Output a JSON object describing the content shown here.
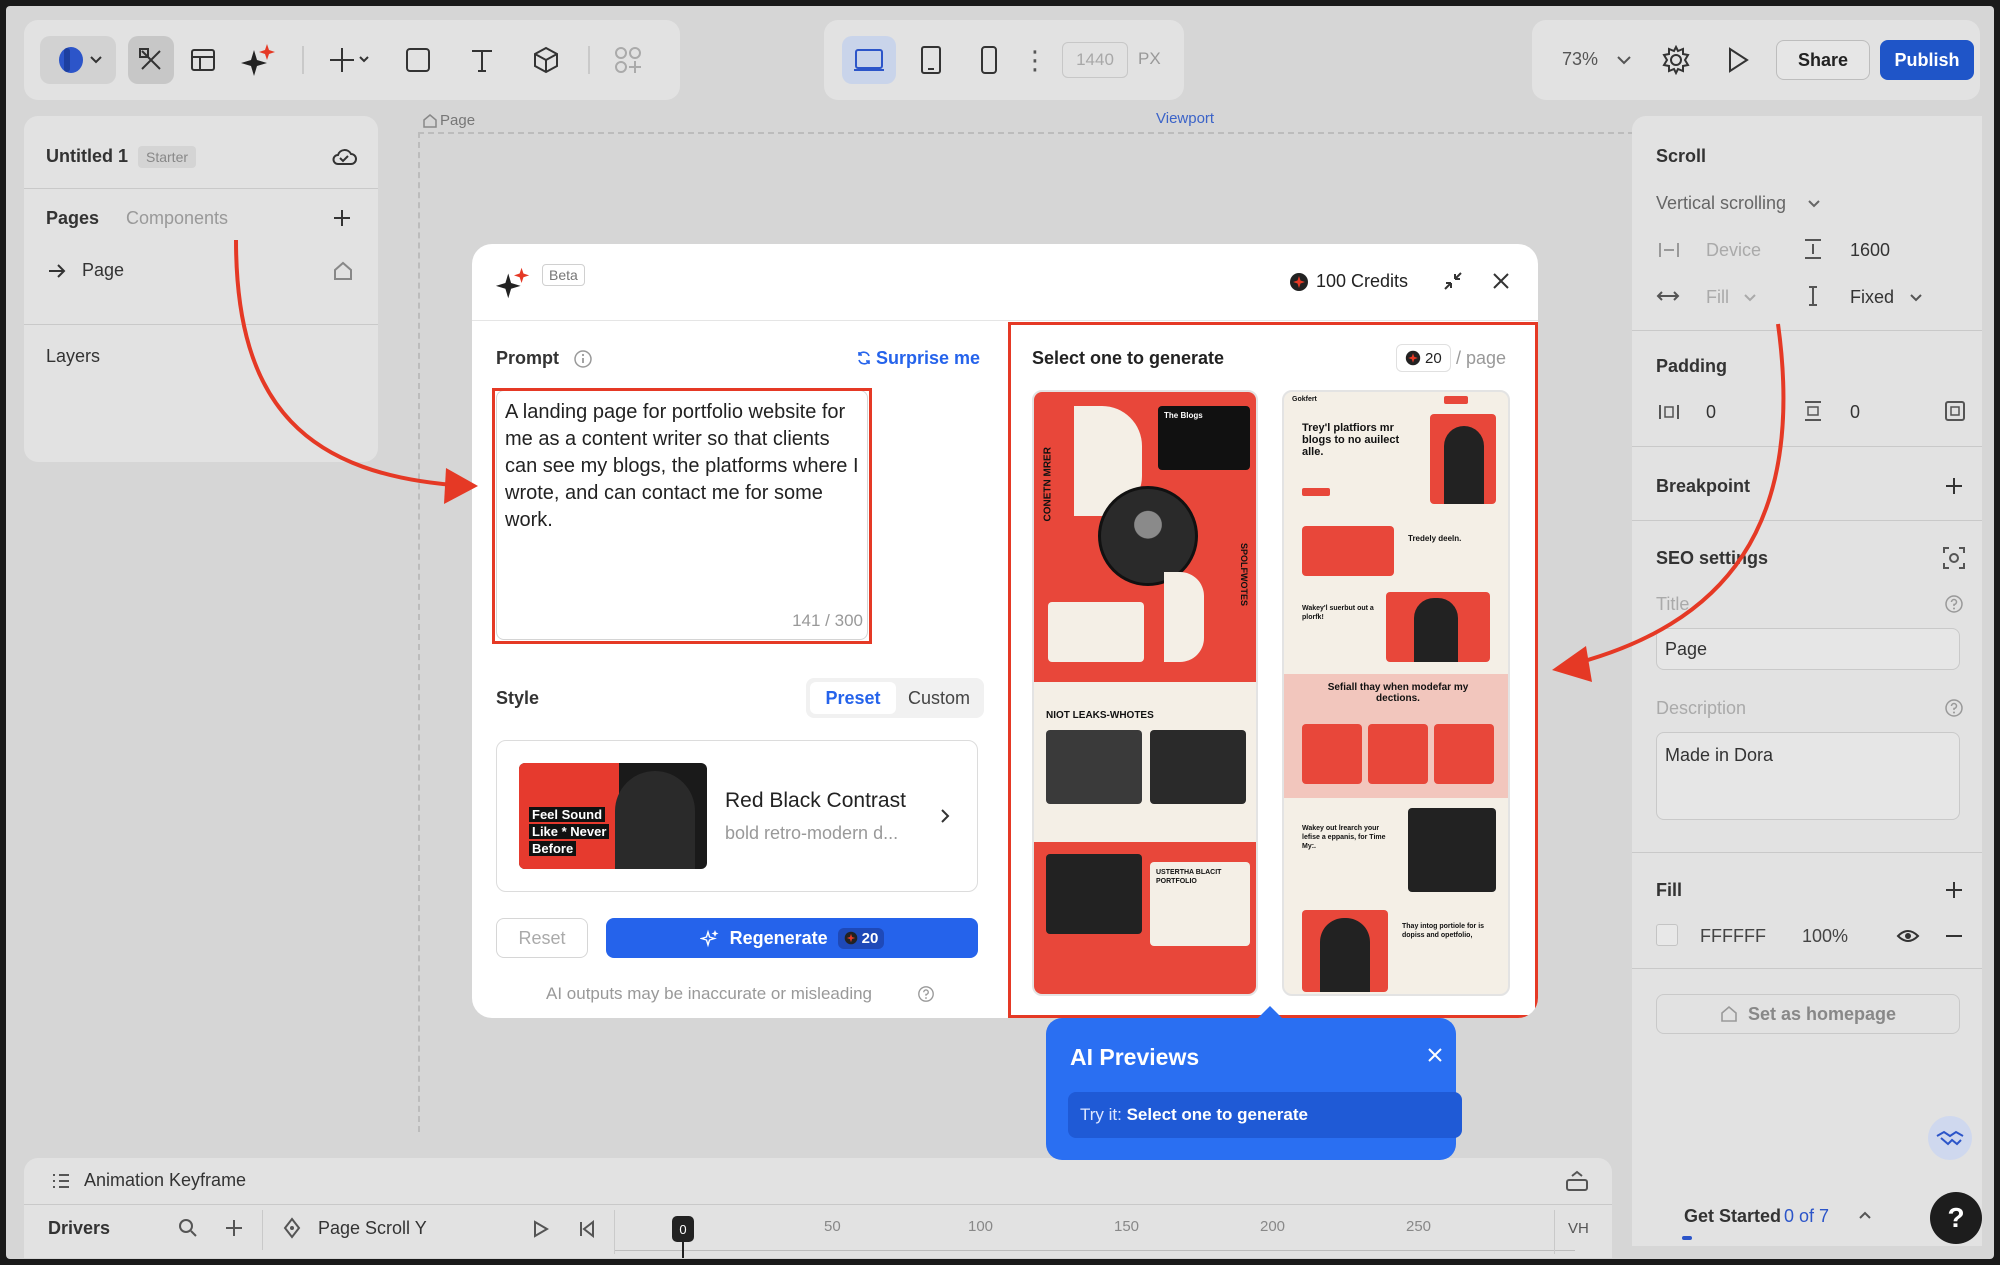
{
  "toolbar": {
    "viewport_width": "1440",
    "viewport_unit": "PX",
    "zoom": "73%",
    "share_label": "Share",
    "publish_label": "Publish"
  },
  "left_panel": {
    "project_name": "Untitled 1",
    "plan_badge": "Starter",
    "tab_pages": "Pages",
    "tab_components": "Components",
    "page_item": "Page",
    "layers_title": "Layers"
  },
  "canvas": {
    "breadcrumb": "Page",
    "viewport_label": "Viewport"
  },
  "right_panel": {
    "scroll_title": "Scroll",
    "scroll_mode": "Vertical scrolling",
    "device_label": "Device",
    "height_value": "1600",
    "width_mode": "Fill",
    "height_mode": "Fixed",
    "padding_title": "Padding",
    "padding_h": "0",
    "padding_v": "0",
    "breakpoint_title": "Breakpoint",
    "seo_title": "SEO settings",
    "title_label": "Title",
    "title_value": "Page",
    "description_label": "Description",
    "description_value": "Made in Dora",
    "fill_title": "Fill",
    "fill_hex": "FFFFFF",
    "fill_opacity": "100%",
    "homepage_button": "Set as homepage"
  },
  "bottom_panel": {
    "title": "Animation Keyframe",
    "drivers_label": "Drivers",
    "driver_value": "Page Scroll Y",
    "playhead": "0",
    "ticks": [
      "50",
      "100",
      "150",
      "200",
      "250"
    ],
    "unit": "VH"
  },
  "get_started": {
    "label": "Get Started",
    "progress": "0 of 7"
  },
  "modal": {
    "beta_badge": "Beta",
    "credits": "100 Credits",
    "prompt_label": "Prompt",
    "surprise_label": "Surprise me",
    "prompt_text": "A landing page for portfolio website for me as a content writer so that clients can see my blogs, the platforms where I wrote, and can contact me for some work.",
    "char_count": "141 / 300",
    "style_label": "Style",
    "style_tab_preset": "Preset",
    "style_tab_custom": "Custom",
    "style_name": "Red Black Contrast",
    "style_desc": "bold retro-modern d...",
    "style_thumb_headline": [
      "Feel Sound",
      "Like * Never",
      "Before"
    ],
    "reset_label": "Reset",
    "regenerate_label": "Regenerate",
    "regenerate_cost": "20",
    "disclaimer": "AI outputs may be inaccurate or misleading",
    "select_title": "Select one to generate",
    "per_page_cost": "20",
    "per_page_label": "/ page"
  },
  "previews": {
    "left": {
      "side_text": "CONETN MRER",
      "box_title": "The Blogs",
      "section_title": "NIOT LEAKS-WHOTES",
      "sub_title": "USTERTHA BLACIT PORTFOLIO",
      "vertical_text": "SPOLFWOTES"
    },
    "right": {
      "brand": "Gokfert",
      "hero_title": "Trey'l platfiors mr blogs to no auilect alle.",
      "row1_title": "Tredely deeln.",
      "row2_title": "Wakey'l suerbut out a plorfk!",
      "band_title": "Sefiall thay when modefar my dections.",
      "row3_title": "Wakey out lrearch your lefise a eppanis, for Time My:.",
      "row4_title": "Thay intog portiole for is dopiss and opetfolio,"
    }
  },
  "ai_tip": {
    "title": "AI Previews",
    "try_prefix": "Try it: ",
    "try_action": "Select one to generate"
  },
  "colors": {
    "accent_blue": "#2563eb",
    "annotation_red": "#e53925",
    "preview_red": "#e8473a",
    "preview_cream": "#f4efe6"
  }
}
